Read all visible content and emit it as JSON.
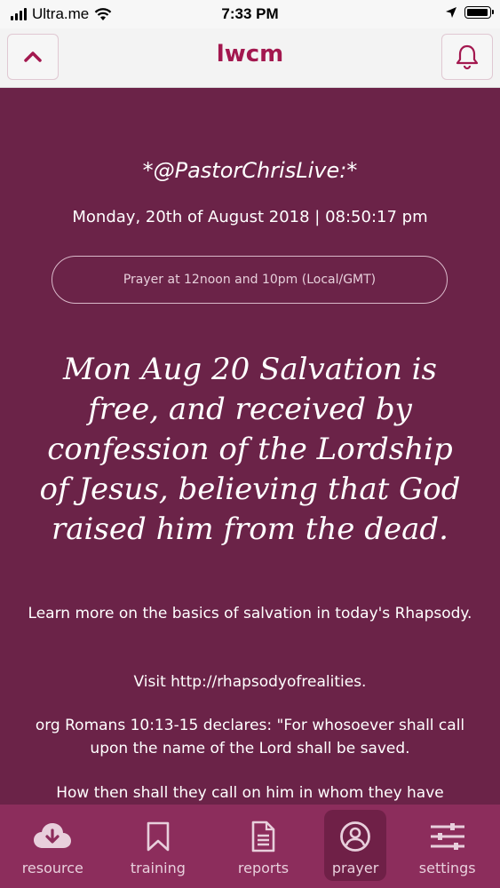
{
  "status_bar": {
    "carrier": "Ultra.me",
    "time": "7:33 PM"
  },
  "header": {
    "title": "lwcm"
  },
  "message": {
    "handle": "*@PastorChrisLive:*",
    "datetime": "Monday, 20th of August 2018 | 08:50:17 pm",
    "prayer_info": "Prayer at 12noon and 10pm (Local/GMT)",
    "headline": "Mon Aug 20 Salvation is free, and received by confession of the Lordship of Jesus, believing that God raised him from the dead.",
    "paragraphs": [
      "Learn more on the basics of salvation in today's Rhapsody.",
      "Visit http://rhapsodyofrealities.",
      "org Romans 10:13-15 declares: \"For whosoever shall call upon the name of the Lord shall be saved.",
      "How then shall they call on him in whom they have"
    ]
  },
  "bottom_nav": {
    "items": [
      {
        "label": "resource",
        "icon": "cloud-download-icon"
      },
      {
        "label": "training",
        "icon": "bookmark-icon"
      },
      {
        "label": "reports",
        "icon": "document-icon"
      },
      {
        "label": "prayer",
        "icon": "user-circle-icon",
        "active": true
      },
      {
        "label": "settings",
        "icon": "sliders-icon"
      }
    ]
  },
  "colors": {
    "background": "#6b2348",
    "accent": "#a3184f",
    "nav": "#8c2d5c"
  }
}
